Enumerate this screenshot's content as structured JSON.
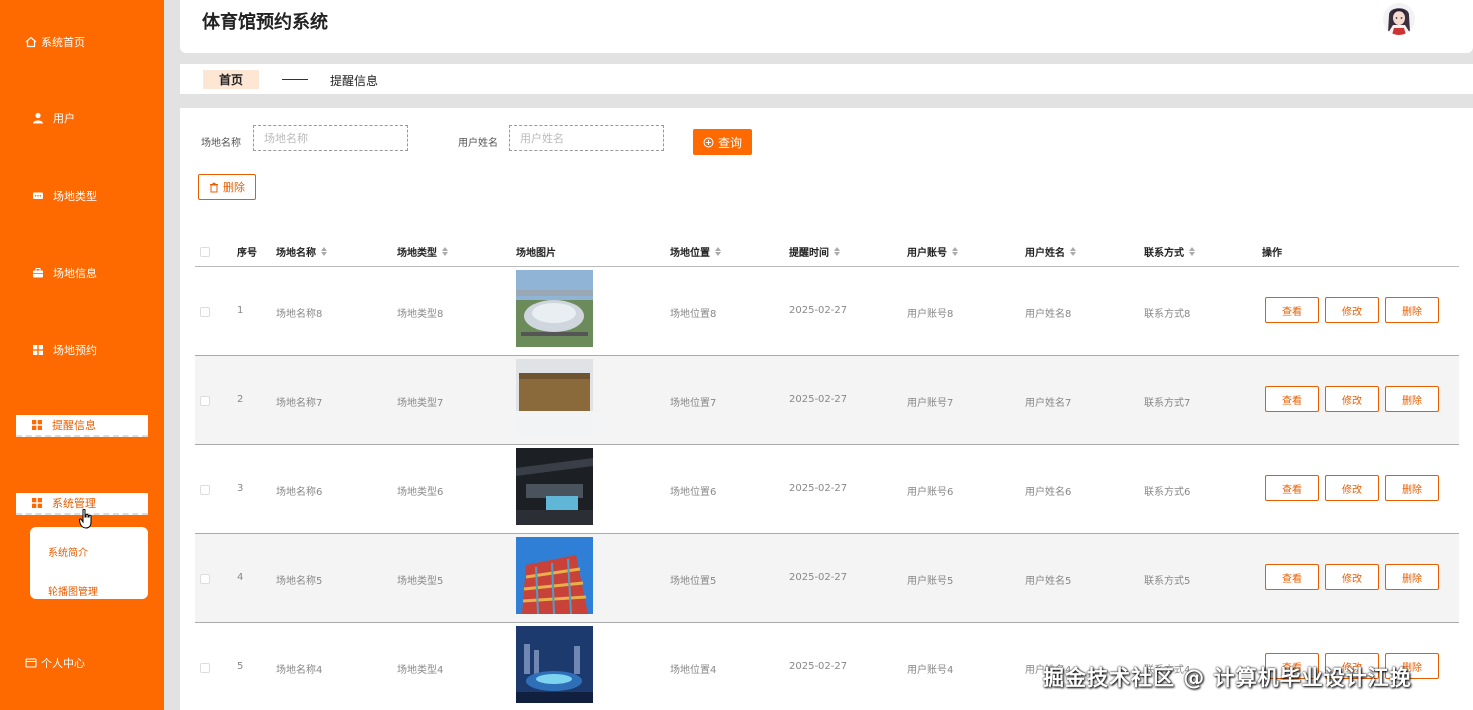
{
  "sidebar": {
    "items": [
      {
        "label": "系统首页",
        "icon": "home-icon"
      },
      {
        "label": "用户",
        "icon": "user-icon"
      },
      {
        "label": "场地类型",
        "icon": "chat-icon"
      },
      {
        "label": "场地信息",
        "icon": "briefcase-icon"
      },
      {
        "label": "场地预约",
        "icon": "grid-icon"
      },
      {
        "label": "提醒信息",
        "icon": "grid-icon"
      },
      {
        "label": "系统管理",
        "icon": "grid-icon"
      },
      {
        "label": "个人中心",
        "icon": "window-icon"
      }
    ],
    "submenu": [
      {
        "label": "系统简介"
      },
      {
        "label": "轮播图管理"
      }
    ]
  },
  "header": {
    "title": "体育馆预约系统"
  },
  "breadcrumb": {
    "home": "首页",
    "current": "提醒信息"
  },
  "filters": {
    "venue_label": "场地名称",
    "venue_placeholder": "场地名称",
    "username_label": "用户姓名",
    "username_placeholder": "用户姓名",
    "query_label": "查询",
    "delete_label": "删除"
  },
  "table": {
    "columns": [
      "序号",
      "场地名称",
      "场地类型",
      "场地图片",
      "场地位置",
      "提醒时间",
      "用户账号",
      "用户姓名",
      "联系方式",
      "操作"
    ],
    "actions": {
      "view": "查看",
      "edit": "修改",
      "delete": "删除"
    },
    "rows": [
      {
        "no": "1",
        "name": "场地名称8",
        "type": "场地类型8",
        "location": "场地位置8",
        "time": "2025-02-27",
        "account": "用户账号8",
        "username": "用户姓名8",
        "contact": "联系方式8"
      },
      {
        "no": "2",
        "name": "场地名称7",
        "type": "场地类型7",
        "location": "场地位置7",
        "time": "2025-02-27",
        "account": "用户账号7",
        "username": "用户姓名7",
        "contact": "联系方式7"
      },
      {
        "no": "3",
        "name": "场地名称6",
        "type": "场地类型6",
        "location": "场地位置6",
        "time": "2025-02-27",
        "account": "用户账号6",
        "username": "用户姓名6",
        "contact": "联系方式6"
      },
      {
        "no": "4",
        "name": "场地名称5",
        "type": "场地类型5",
        "location": "场地位置5",
        "time": "2025-02-27",
        "account": "用户账号5",
        "username": "用户姓名5",
        "contact": "联系方式5"
      },
      {
        "no": "5",
        "name": "场地名称4",
        "type": "场地类型4",
        "location": "场地位置4",
        "time": "2025-02-27",
        "account": "用户账号4",
        "username": "用户姓名4",
        "contact": "联系方式4"
      }
    ]
  },
  "watermark": "掘金技术社区 @ 计算机毕业设计江挽",
  "colors": {
    "accent": "#ff6a00",
    "accent_text": "#e85d00",
    "crumb_bg": "#fde6d3"
  }
}
